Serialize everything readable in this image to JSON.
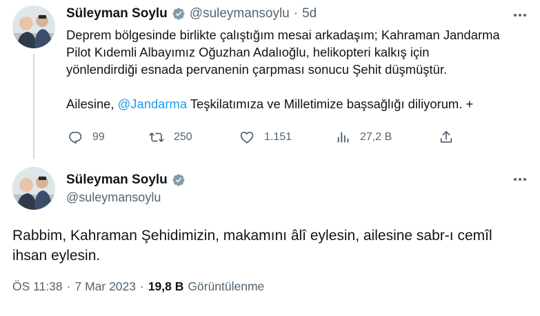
{
  "tweet1": {
    "author": "Süleyman Soylu",
    "handle": "@suleymansoylu",
    "separator": "·",
    "time": "5d",
    "line1": "Deprem bölgesinde birlikte çalıştığım mesai arkadaşım; Kahraman Jandarma",
    "line2": "Pilot Kıdemli Albayımız Oğuzhan Adalıoğlu, helikopteri kalkış için",
    "line3": "yönlendirdiği esnada pervanenin çarpması sonucu Şehit düşmüştür.",
    "line4_prefix": "Ailesine, ",
    "mention": "@Jandarma",
    "line4_suffix": " Teşkilatımıza ve Milletimize başsağlığı diliyorum. +",
    "replies": "99",
    "retweets": "250",
    "likes": "1.151",
    "views": "27,2 B"
  },
  "tweet2": {
    "author": "Süleyman Soylu",
    "handle": "@suleymansoylu",
    "line1": "Rabbim, Kahraman Şehidimizin, makamını âlî eylesin, ailesine sabr-ı cemîl",
    "line2": "ihsan eylesin.",
    "time": "ÖS 11:38",
    "dot1": "·",
    "date": "7 Mar 2023",
    "dot2": "·",
    "views_count": "19,8 B",
    "views_label": "Görüntülenme"
  },
  "icons": {
    "verified": "verified-badge-icon",
    "more": "more-dots-icon",
    "reply": "reply-icon",
    "retweet": "retweet-icon",
    "like": "heart-icon",
    "views": "analytics-icon",
    "share": "share-icon"
  },
  "colors": {
    "text": "#0f1419",
    "muted": "#536471",
    "link": "#1d9bf0",
    "thread_line": "#cfd9de"
  }
}
